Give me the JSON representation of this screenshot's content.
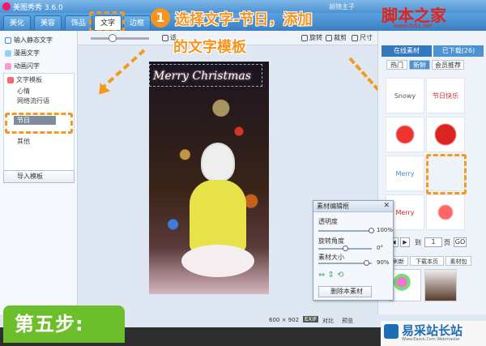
{
  "window": {
    "title": "美图秀秀 3.6.0",
    "user": "胡锦主子"
  },
  "nav": {
    "tabs": [
      "美化",
      "美容",
      "饰品",
      "文字",
      "边框"
    ],
    "active": "文字"
  },
  "toolbar": {
    "tools": [
      "适",
      "旋转",
      "裁剪",
      "尺寸"
    ]
  },
  "left_panel": {
    "items": [
      "输入静态文字",
      "漫画文字",
      "动画闪字"
    ],
    "tree_header": "文字模板",
    "tree_items": [
      "心情",
      "网络流行语",
      "节日",
      "其他"
    ],
    "tree_selected": "节日",
    "import_label": "导入模板"
  },
  "overlay": {
    "step_number": "1",
    "title_line1": "选择文字-节日，添加",
    "title_line2": "的文字模板",
    "watermark": "脚本之家",
    "watermark_url": "www.jb51.net"
  },
  "canvas": {
    "text": "Merry Christmas"
  },
  "right_panel": {
    "tabs": [
      "在线素材",
      "已下载(26)"
    ],
    "subtabs": [
      "热门",
      "新鲜",
      "会员推荐"
    ],
    "stickers": [
      "Snowy Christmas!",
      "节日快乐",
      "",
      "",
      "Merry Christmas",
      "",
      "Merry Christmas",
      ""
    ],
    "pager": {
      "page_value": "1",
      "page_suffix": "页",
      "to_label": "到",
      "go_label": "GO"
    },
    "buttons": [
      "刷新",
      "下载本页",
      "素材包"
    ]
  },
  "dialog": {
    "title": "素材编辑框",
    "opacity_label": "透明度",
    "opacity_value": "100%",
    "rotate_label": "旋转角度",
    "rotate_value": "0°",
    "size_label": "素材大小",
    "size_value": "90%",
    "delete_label": "删除本素材"
  },
  "status": {
    "dimensions": "600 × 902",
    "exif": "EXIF",
    "compare": "对比",
    "preview": "预览"
  },
  "badge": {
    "step": "第五步:"
  },
  "logo": {
    "name": "易采站长站",
    "sub": "Www.Easck.Com Webmaster"
  }
}
